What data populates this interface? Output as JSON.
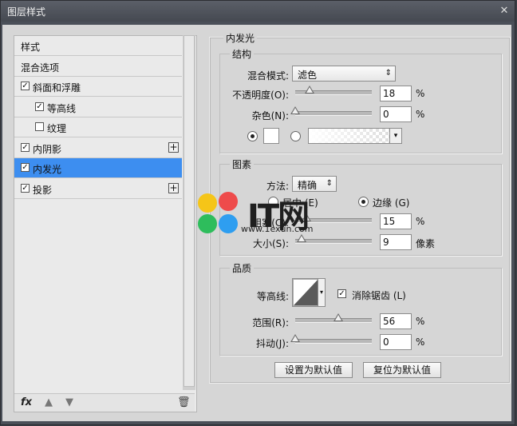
{
  "window": {
    "title": "图层样式",
    "close_glyph": "✕"
  },
  "sidebar": {
    "items": [
      {
        "label": "样式",
        "checkbox": false,
        "checked": false,
        "plus": false,
        "selected": false
      },
      {
        "label": "混合选项",
        "checkbox": false,
        "checked": false,
        "plus": false,
        "selected": false
      },
      {
        "label": "斜面和浮雕",
        "checkbox": true,
        "checked": true,
        "plus": false,
        "selected": false
      },
      {
        "label": "等高线",
        "checkbox": true,
        "checked": true,
        "plus": false,
        "selected": false
      },
      {
        "label": "纹理",
        "checkbox": true,
        "checked": false,
        "plus": false,
        "selected": false
      },
      {
        "label": "内阴影",
        "checkbox": true,
        "checked": true,
        "plus": true,
        "selected": false
      },
      {
        "label": "内发光",
        "checkbox": true,
        "checked": true,
        "plus": false,
        "selected": true
      },
      {
        "label": "投影",
        "checkbox": true,
        "checked": true,
        "plus": true,
        "selected": false
      }
    ],
    "bottom_icons": {
      "fx": "fx",
      "up": "▲",
      "down": "▼",
      "trash": "🗑"
    }
  },
  "panel": {
    "title": "内发光",
    "structure": {
      "title": "结构",
      "blend_mode_label": "混合模式:",
      "blend_mode_value": "滤色",
      "opacity_label": "不透明度(O):",
      "opacity_value": "18",
      "noise_label": "杂色(N):",
      "noise_value": "0",
      "percent": "%"
    },
    "elements": {
      "title": "图素",
      "method_label": "方法:",
      "method_value": "精确",
      "source_center_label": "居中 (E)",
      "source_edge_label": "边缘 (G)",
      "choke_label": "阻塞(C):",
      "choke_value": "15",
      "size_label": "大小(S):",
      "size_value": "9",
      "percent": "%",
      "pixels": "像素"
    },
    "quality": {
      "title": "品质",
      "contour_label": "等高线:",
      "antialias_label": "消除锯齿 (L)",
      "range_label": "范围(R):",
      "range_value": "56",
      "jitter_label": "抖动(J):",
      "jitter_value": "0",
      "percent": "%"
    },
    "buttons": {
      "make_default": "设置为默认值",
      "reset_default": "复位为默认值"
    }
  },
  "watermark": {
    "text": "IT网",
    "url": "www.1exun.com"
  },
  "colors": {
    "selection": "#3d8ef0",
    "panel_bg": "#d6d6d6"
  }
}
